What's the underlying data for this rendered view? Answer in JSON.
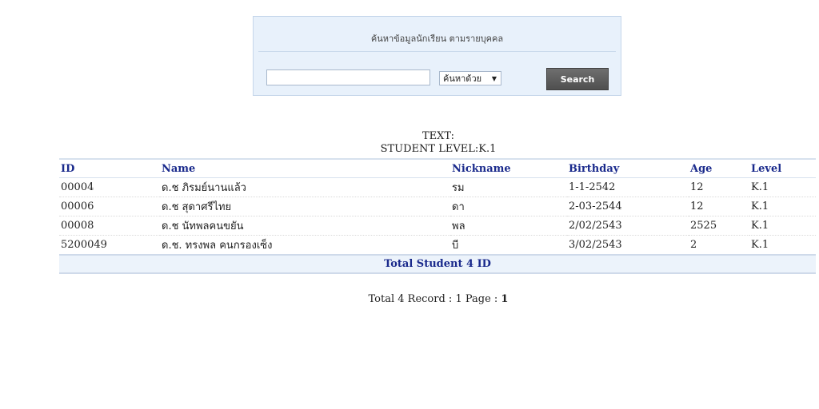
{
  "search": {
    "title": "ค้นหาข้อมูลนักเรียน ตามรายบุคคล",
    "input_value": "",
    "input_placeholder": "",
    "select_value": "ค้นหาด้วย",
    "button_label": "Search"
  },
  "caption": {
    "line1": "TEXT:",
    "line2": "STUDENT LEVEL:K.1"
  },
  "table": {
    "headers": [
      "ID",
      "Name",
      "Nickname",
      "Birthday",
      "Age",
      "Level"
    ],
    "rows": [
      [
        "00004",
        "ด.ช ภิรมย์นานแล้ว",
        "รม",
        "1-1-2542",
        "12",
        "K.1"
      ],
      [
        "00006",
        "ด.ช สุดาศรีไทย",
        "ดา",
        "2-03-2544",
        "12",
        "K.1"
      ],
      [
        "00008",
        "ด.ช นัทพลคนขยัน",
        "พล",
        "2/02/2543",
        "2525",
        "K.1"
      ],
      [
        "5200049",
        "ด.ช. ทรงพล  คนกรองเซ็ง",
        "บี",
        "3/02/2543",
        "2",
        "K.1"
      ]
    ],
    "total": "Total Student 4 ID"
  },
  "pager": {
    "prefix": "Total 4 Record : 1 Page : ",
    "current": "1"
  }
}
